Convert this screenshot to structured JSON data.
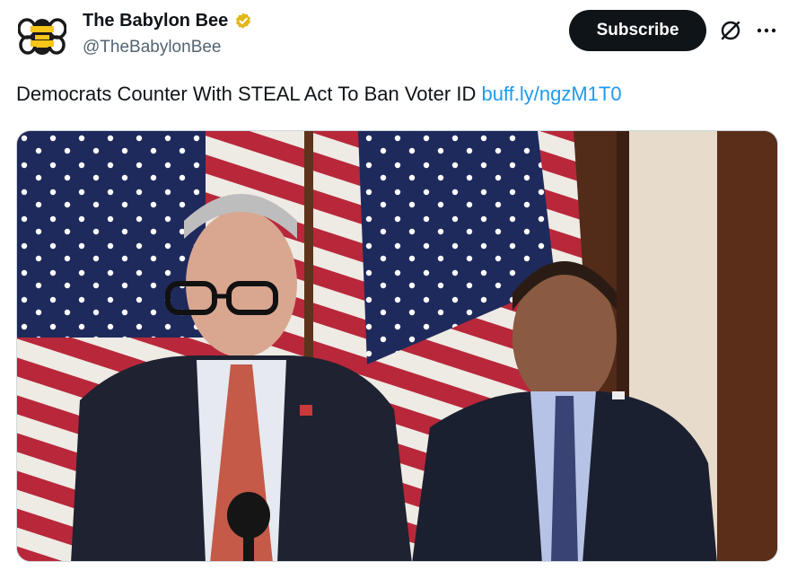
{
  "account": {
    "name": "The Babylon Bee",
    "handle": "@TheBabylonBee",
    "avatar_icon": "bee-logo-icon",
    "verified_icon": "gold-verified-badge-icon"
  },
  "actions": {
    "subscribe_label": "Subscribe",
    "grok_icon": "grok-icon",
    "more_icon": "more-options-icon"
  },
  "tweet": {
    "text": "Democrats Counter With STEAL Act To Ban Voter ID ",
    "link": "buff.ly/ngzM1T0"
  },
  "colors": {
    "link": "#1d9bf0",
    "subscribe_bg": "#0f1419",
    "verified_gold": "#e2b719",
    "handle_gray": "#536471"
  }
}
